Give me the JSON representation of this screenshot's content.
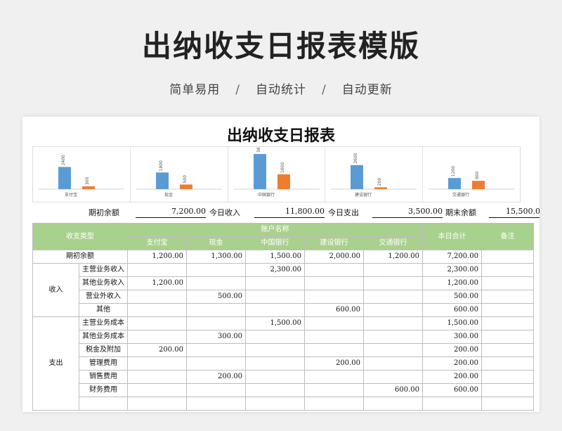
{
  "page": {
    "title": "出纳收支日报表模版",
    "subtitle": [
      "简单易用",
      "自动统计",
      "自动更新"
    ],
    "separator": "/"
  },
  "sheet": {
    "title": "出纳收支日报表"
  },
  "chart_data": {
    "type": "bar",
    "categories": [
      "支付宝",
      "现金",
      "中国银行",
      "建设银行",
      "交通银行"
    ],
    "series": [
      {
        "values": [
          2400,
          1800,
          3800,
          2600,
          1200
        ],
        "color": "#5b9bd5"
      },
      {
        "values": [
          300,
          500,
          1600,
          200,
          900
        ],
        "color": "#ed7d31"
      }
    ],
    "ylim": [
      0,
      3800
    ]
  },
  "summary": {
    "opening_label": "期初余额",
    "opening_value": "7,200.00",
    "income_label": "今日收入",
    "income_value": "11,800.00",
    "expense_label": "今日支出",
    "expense_value": "3,500.00",
    "closing_label": "期末余额",
    "closing_value": "15,500.00"
  },
  "table": {
    "headers": {
      "type": "收支类型",
      "account_name": "账户名称",
      "accounts": [
        "支付宝",
        "现金",
        "中国银行",
        "建设银行",
        "交通银行"
      ],
      "total": "本日合计",
      "note": "备注"
    },
    "opening_row": {
      "label": "期初余额",
      "values": [
        "1,200.00",
        "1,300.00",
        "1,500.00",
        "2,000.00",
        "1,200.00"
      ],
      "total": "7,200.00"
    },
    "groups": [
      {
        "name": "收入",
        "rows": [
          {
            "item": "主营业务收入",
            "values": [
              "",
              "",
              "2,300.00",
              "",
              ""
            ],
            "total": "2,300.00"
          },
          {
            "item": "其他业务收入",
            "values": [
              "1,200.00",
              "",
              "",
              "",
              ""
            ],
            "total": "1,200.00"
          },
          {
            "item": "营业外收入",
            "values": [
              "",
              "500.00",
              "",
              "",
              ""
            ],
            "total": "500.00"
          },
          {
            "item": "其他",
            "values": [
              "",
              "",
              "",
              "600.00",
              ""
            ],
            "total": "600.00"
          }
        ]
      },
      {
        "name": "支出",
        "rows": [
          {
            "item": "主营业务成本",
            "values": [
              "",
              "",
              "1,500.00",
              "",
              ""
            ],
            "total": "1,500.00"
          },
          {
            "item": "其他业务成本",
            "values": [
              "",
              "300.00",
              "",
              "",
              ""
            ],
            "total": "300.00"
          },
          {
            "item": "税金及附加",
            "values": [
              "200.00",
              "",
              "",
              "",
              ""
            ],
            "total": "200.00"
          },
          {
            "item": "管理费用",
            "values": [
              "",
              "",
              "",
              "200.00",
              ""
            ],
            "total": "200.00"
          },
          {
            "item": "销售费用",
            "values": [
              "",
              "200.00",
              "",
              "",
              ""
            ],
            "total": "200.00"
          },
          {
            "item": "财务费用",
            "values": [
              "",
              "",
              "",
              "",
              "600.00"
            ],
            "total": "600.00"
          },
          {
            "item": "",
            "values": [
              "",
              "",
              "",
              "",
              ""
            ],
            "total": ""
          }
        ]
      }
    ]
  }
}
